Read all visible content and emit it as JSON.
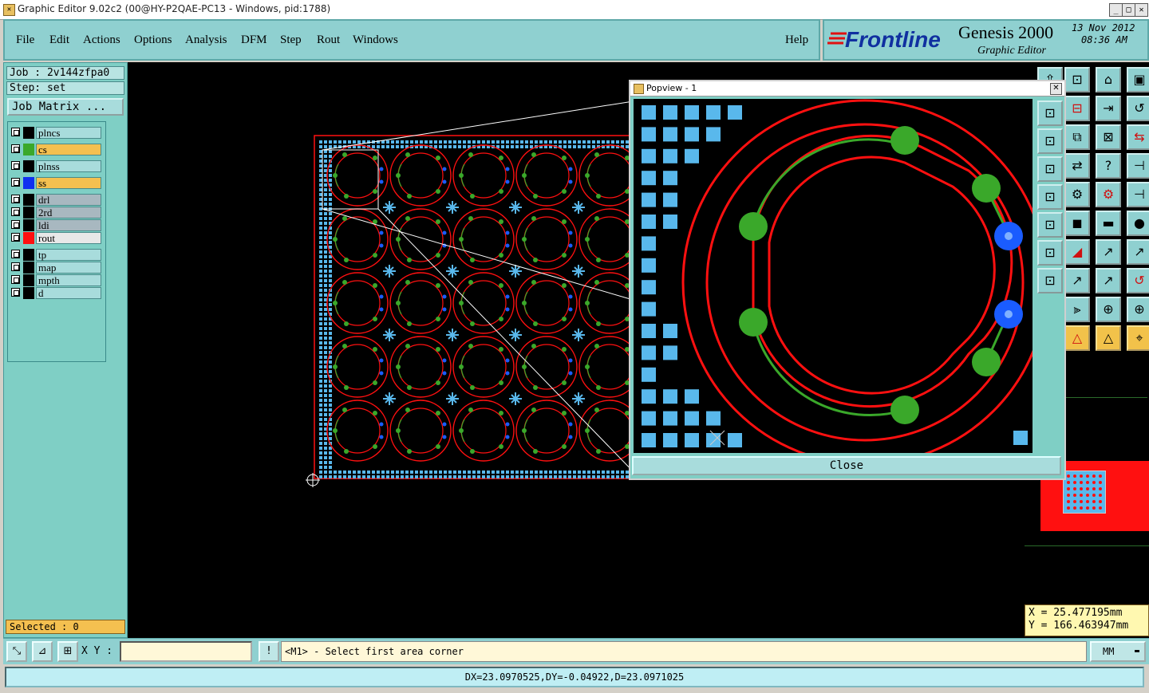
{
  "window": {
    "title": "Graphic Editor 9.02c2 (00@HY-P2QAE-PC13 - Windows, pid:1788)",
    "minimize": "_",
    "maximize": "□",
    "close": "✕"
  },
  "menu": {
    "items": [
      "File",
      "Edit",
      "Actions",
      "Options",
      "Analysis",
      "DFM",
      "Step",
      "Rout",
      "Windows"
    ],
    "help": "Help"
  },
  "brand": {
    "logo": "Frontline",
    "product": "Genesis 2000",
    "module": "Graphic Editor",
    "date": "13 Nov 2012",
    "time": "08:36 AM"
  },
  "job": {
    "job_label": "Job : 2v144zfpa0",
    "step_label": "Step: set",
    "matrix_button": "Job Matrix ..."
  },
  "layers": [
    {
      "name": "plncs",
      "color": "#000000",
      "bg": "#a8dcdc"
    },
    {
      "name": "cs",
      "color": "#3aa82a",
      "bg": "#f4c050"
    },
    {
      "name": "plnss",
      "color": "#000000",
      "bg": "#a8dcdc"
    },
    {
      "name": "ss",
      "color": "#1030f0",
      "bg": "#f4c050"
    },
    {
      "name": "drl",
      "color": "#000000",
      "bg": "#a8b8c0"
    },
    {
      "name": "2rd",
      "color": "#000000",
      "bg": "#a8b8c0"
    },
    {
      "name": "ldi",
      "color": "#000000",
      "bg": "#a8b8c0"
    },
    {
      "name": "rout",
      "color": "#ff1010",
      "bg": "#e8e8e8"
    },
    {
      "name": "tp",
      "color": "#000000",
      "bg": "#a8dcdc"
    },
    {
      "name": "map",
      "color": "#000000",
      "bg": "#a8dcdc"
    },
    {
      "name": "mpth",
      "color": "#000000",
      "bg": "#a8dcdc"
    },
    {
      "name": "d",
      "color": "#000000",
      "bg": "#a8dcdc"
    }
  ],
  "selected": "Selected : 0",
  "popview": {
    "title": "Popview - 1",
    "close_button": "Close"
  },
  "coords": {
    "x": "X = 25.477195mm",
    "y": "Y = 166.463947mm"
  },
  "bottom": {
    "xy_label": "X Y :",
    "xy_value": "",
    "prompt": "<M1> - Select first area corner",
    "units": "MM",
    "alert": "!"
  },
  "status": "DX=23.0970525,DY=-0.04922,D=23.0971025",
  "colors": {
    "route": "#ff1010",
    "copper": "#3aa82a",
    "pad_blue": "#1a5cff",
    "mask": "#59b8ec",
    "panel": "#8fd0d0"
  }
}
